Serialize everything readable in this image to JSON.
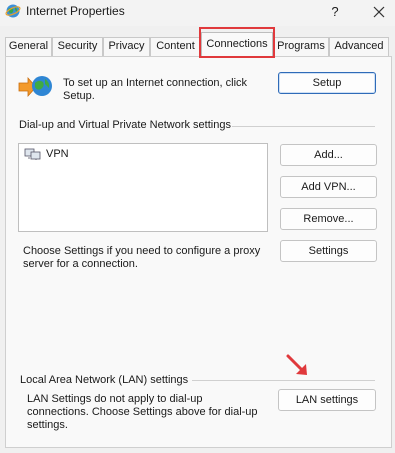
{
  "window": {
    "title": "Internet Properties",
    "help_label": "?",
    "icon": "internet-globe-icon",
    "close_icon": "close-icon"
  },
  "tabs": [
    {
      "label": "General",
      "active": false
    },
    {
      "label": "Security",
      "active": false
    },
    {
      "label": "Privacy",
      "active": false
    },
    {
      "label": "Content",
      "active": false
    },
    {
      "label": "Connections",
      "active": true
    },
    {
      "label": "Programs",
      "active": false
    },
    {
      "label": "Advanced",
      "active": false
    }
  ],
  "setup": {
    "text": "To set up an Internet connection, click Setup.",
    "button": "Setup"
  },
  "dialup": {
    "heading": "Dial-up and Virtual Private Network settings",
    "entries": [
      {
        "label": "VPN",
        "icon": "network-connection-icon"
      }
    ],
    "add_button": "Add...",
    "add_vpn_button": "Add VPN...",
    "remove_button": "Remove...",
    "proxy_text": "Choose Settings if you need to configure a proxy server for a connection.",
    "settings_button": "Settings"
  },
  "lan": {
    "heading": "Local Area Network (LAN) settings",
    "text": "LAN Settings do not apply to dial-up connections. Choose Settings above for dial-up settings.",
    "button": "LAN settings"
  },
  "annotations": {
    "highlight_color": "#e0393c",
    "arrow": "red-arrow-icon"
  }
}
